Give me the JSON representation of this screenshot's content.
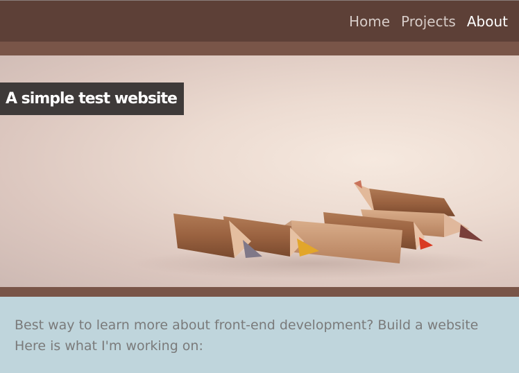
{
  "nav": {
    "links": [
      {
        "label": "Home"
      },
      {
        "label": "Projects"
      },
      {
        "label": "About"
      }
    ]
  },
  "hero": {
    "title": "A simple test website"
  },
  "content": {
    "line1": "Best way to learn more about front-end development? Build a website",
    "line2": "Here is what I'm working on:"
  },
  "colors": {
    "navbar": "#5d4037",
    "band": "#795548",
    "content_bg": "#bfd5dc",
    "title_bg": "#3e3a39"
  }
}
